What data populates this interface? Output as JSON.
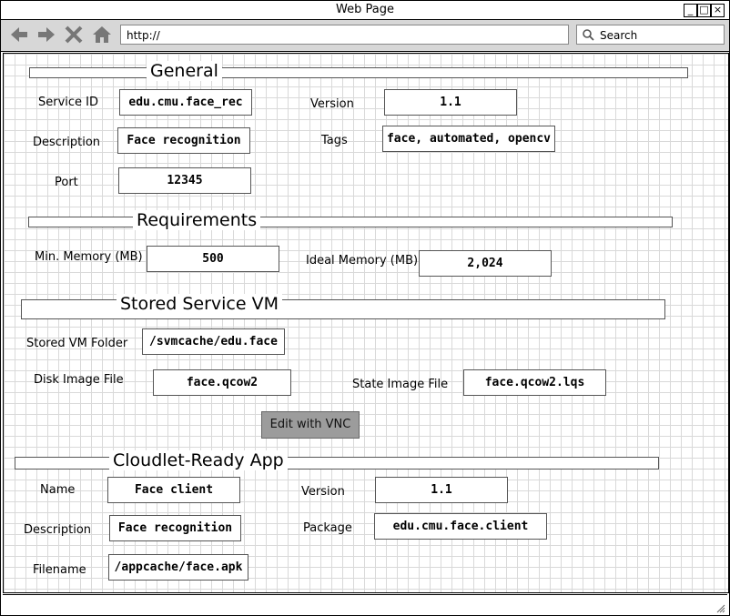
{
  "window": {
    "title": "Web Page"
  },
  "toolbar": {
    "url": "http://",
    "search_placeholder": "Search"
  },
  "general": {
    "heading": "General",
    "service_id_label": "Service ID",
    "service_id": "edu.cmu.face_rec",
    "version_label": "Version",
    "version": "1.1",
    "description_label": "Description",
    "description": "Face recognition",
    "tags_label": "Tags",
    "tags": "face, automated, opencv",
    "port_label": "Port",
    "port": "12345"
  },
  "requirements": {
    "heading": "Requirements",
    "min_memory_label": "Min. Memory (MB)",
    "min_memory": "500",
    "ideal_memory_label": "Ideal Memory (MB)",
    "ideal_memory": "2,024"
  },
  "stored_vm": {
    "heading": "Stored Service VM",
    "folder_label": "Stored VM Folder",
    "folder": "/svmcache/edu.face",
    "disk_label": "Disk Image File",
    "disk": "face.qcow2",
    "state_label": "State Image File",
    "state": "face.qcow2.lqs",
    "vnc_button": "Edit with VNC"
  },
  "app": {
    "heading": "Cloudlet-Ready App",
    "name_label": "Name",
    "name": "Face client",
    "version_label": "Version",
    "version": "1.1",
    "description_label": "Description",
    "description": "Face recognition",
    "package_label": "Package",
    "package": "edu.cmu.face.client",
    "filename_label": "Filename",
    "filename": "/appcache/face.apk"
  },
  "icons": [
    "back-icon",
    "forward-icon",
    "stop-icon",
    "home-icon",
    "search-icon",
    "minimize-icon",
    "maximize-icon",
    "close-icon",
    "resize-grip-icon"
  ]
}
